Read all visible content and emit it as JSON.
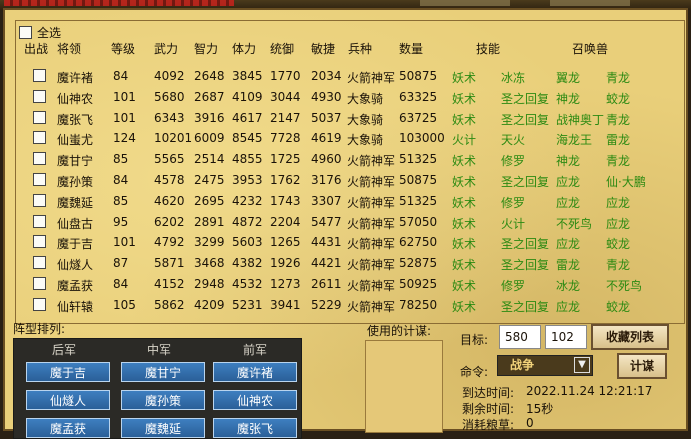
{
  "header": {
    "select_all": "全选",
    "columns": [
      "出战",
      "将领",
      "等级",
      "武力",
      "智力",
      "体力",
      "统御",
      "敏捷",
      "兵种",
      "数量",
      "技能",
      "召唤兽"
    ]
  },
  "rows": [
    {
      "name": "魔许褚",
      "level": "84",
      "str": "4092",
      "int": "2648",
      "hp": "3845",
      "cmd": "1770",
      "agi": "2034",
      "troop": "火箭神军",
      "count": "50875",
      "skill1": "妖术",
      "skill2": "冰冻",
      "beast1": "翼龙",
      "beast2": "青龙"
    },
    {
      "name": "仙神农",
      "level": "101",
      "str": "5680",
      "int": "2687",
      "hp": "4109",
      "cmd": "3044",
      "agi": "4930",
      "troop": "大象骑",
      "count": "63325",
      "skill1": "妖术",
      "skill2": "圣之回复",
      "beast1": "神龙",
      "beast2": "蛟龙"
    },
    {
      "name": "魔张飞",
      "level": "101",
      "str": "6343",
      "int": "3916",
      "hp": "4617",
      "cmd": "2147",
      "agi": "5037",
      "troop": "大象骑",
      "count": "63725",
      "skill1": "妖术",
      "skill2": "圣之回复",
      "beast1": "战神奥丁",
      "beast2": "青龙"
    },
    {
      "name": "仙蚩尤",
      "level": "124",
      "str": "10201",
      "int": "6009",
      "hp": "8545",
      "cmd": "7728",
      "agi": "4619",
      "troop": "大象骑",
      "count": "103000",
      "skill1": "火计",
      "skill2": "天火",
      "beast1": "海龙王",
      "beast2": "雷龙"
    },
    {
      "name": "魔甘宁",
      "level": "85",
      "str": "5565",
      "int": "2514",
      "hp": "4855",
      "cmd": "1725",
      "agi": "4960",
      "troop": "火箭神军",
      "count": "51325",
      "skill1": "妖术",
      "skill2": "修罗",
      "beast1": "神龙",
      "beast2": "青龙"
    },
    {
      "name": "魔孙策",
      "level": "84",
      "str": "4578",
      "int": "2475",
      "hp": "3953",
      "cmd": "1762",
      "agi": "3176",
      "troop": "火箭神军",
      "count": "50875",
      "skill1": "妖术",
      "skill2": "圣之回复",
      "beast1": "应龙",
      "beast2": "仙·大鹏"
    },
    {
      "name": "魔魏延",
      "level": "85",
      "str": "4620",
      "int": "2695",
      "hp": "4232",
      "cmd": "1743",
      "agi": "3307",
      "troop": "火箭神军",
      "count": "51325",
      "skill1": "妖术",
      "skill2": "修罗",
      "beast1": "应龙",
      "beast2": "应龙"
    },
    {
      "name": "仙盘古",
      "level": "95",
      "str": "6202",
      "int": "2891",
      "hp": "4872",
      "cmd": "2204",
      "agi": "5477",
      "troop": "火箭神军",
      "count": "57050",
      "skill1": "妖术",
      "skill2": "火计",
      "beast1": "不死鸟",
      "beast2": "应龙"
    },
    {
      "name": "魔于吉",
      "level": "101",
      "str": "4792",
      "int": "3299",
      "hp": "5603",
      "cmd": "1265",
      "agi": "4431",
      "troop": "火箭神军",
      "count": "62750",
      "skill1": "妖术",
      "skill2": "圣之回复",
      "beast1": "应龙",
      "beast2": "蛟龙"
    },
    {
      "name": "仙燧人",
      "level": "87",
      "str": "5871",
      "int": "3468",
      "hp": "4382",
      "cmd": "1926",
      "agi": "4421",
      "troop": "火箭神军",
      "count": "52875",
      "skill1": "妖术",
      "skill2": "圣之回复",
      "beast1": "雷龙",
      "beast2": "青龙"
    },
    {
      "name": "魔孟获",
      "level": "84",
      "str": "4152",
      "int": "2948",
      "hp": "4532",
      "cmd": "1273",
      "agi": "2611",
      "troop": "火箭神军",
      "count": "50925",
      "skill1": "妖术",
      "skill2": "修罗",
      "beast1": "冰龙",
      "beast2": "不死鸟"
    },
    {
      "name": "仙轩辕",
      "level": "105",
      "str": "5862",
      "int": "4209",
      "hp": "5231",
      "cmd": "3941",
      "agi": "5229",
      "troop": "火箭神军",
      "count": "78250",
      "skill1": "妖术",
      "skill2": "圣之回复",
      "beast1": "应龙",
      "beast2": "蛟龙"
    }
  ],
  "formation": {
    "title": "阵型排列:",
    "heads": [
      "后军",
      "中军",
      "前军"
    ],
    "slots": [
      [
        "魔于吉",
        "魔甘宁",
        "魔许褚"
      ],
      [
        "仙燧人",
        "魔孙策",
        "仙神农"
      ],
      [
        "魔孟获",
        "魔魏延",
        "魔张飞"
      ]
    ]
  },
  "strategy": {
    "title": "使用的计谋:"
  },
  "target": {
    "label": "目标:",
    "x": "580",
    "y": "102",
    "bookmark_btn": "收藏列表"
  },
  "command": {
    "label": "命令:",
    "value": "战争",
    "btn": "计谋"
  },
  "info": {
    "arrive_label": "到达时间:",
    "arrive_value": "2022.11.24  12:21:17",
    "remain_label": "剩余时间:",
    "remain_value": "15秒",
    "consume_label": "消耗粮草:",
    "consume_value": "0"
  },
  "colors": {
    "panel": "#e9cf7a",
    "green_text": "#2c8a12",
    "blue_button": "#2f6aa6"
  }
}
